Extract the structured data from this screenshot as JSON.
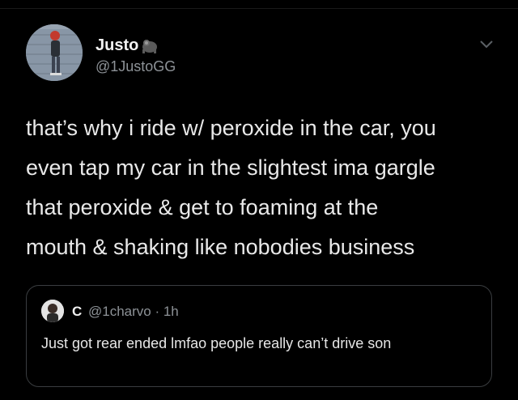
{
  "author": {
    "display_name": "Justo",
    "emoji": "gorilla-emoji",
    "handle": "@1JustoGG"
  },
  "tweet": {
    "text": "that’s why i ride w/ peroxide in the car, you\neven tap my car in the slightest ima gargle\nthat peroxide & get to foaming at the\nmouth & shaking like nobodies business"
  },
  "quoted_tweet": {
    "author_name": "C",
    "handle": "@1charvo",
    "separator": "·",
    "time": "1h",
    "meta": "@1charvo · 1h",
    "text": "Just got rear ended lmfao people really can’t drive son"
  },
  "icons": {
    "menu": "chevron-down-icon"
  },
  "colors": {
    "background": "#000000",
    "text_primary": "#e9e9e9",
    "text_secondary": "#8d9297",
    "card_border": "#3a3d40"
  }
}
